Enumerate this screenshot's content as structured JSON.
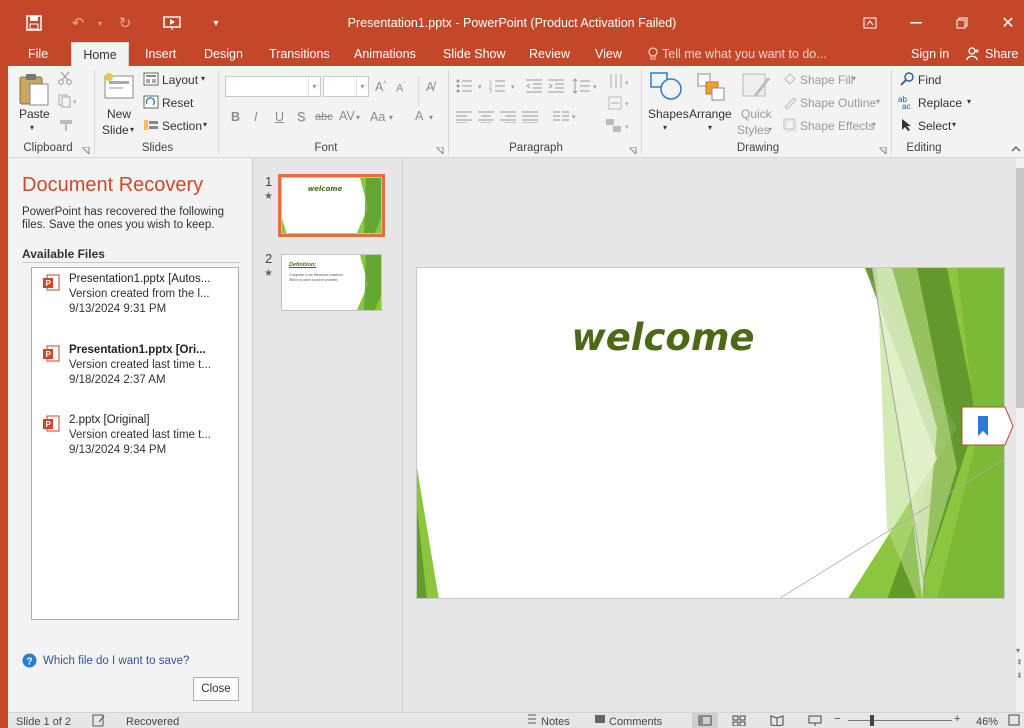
{
  "window": {
    "title": "Presentation1.pptx - PowerPoint (Product Activation Failed)",
    "accent_color": "#c4472a"
  },
  "ribbon_tabs": [
    "File",
    "Home",
    "Insert",
    "Design",
    "Transitions",
    "Animations",
    "Slide Show",
    "Review",
    "View"
  ],
  "tell_me": "Tell me what you want to do...",
  "sign_in": "Sign in",
  "share": "Share",
  "ribbon": {
    "clipboard": {
      "paste": "Paste",
      "label": "Clipboard"
    },
    "slides": {
      "new_slide_line1": "New",
      "new_slide_line2": "Slide",
      "layout": "Layout",
      "reset": "Reset",
      "section": "Section",
      "label": "Slides"
    },
    "font": {
      "label": "Font",
      "bold": "B",
      "italic": "I",
      "underline": "U",
      "shadow": "S",
      "strike": "abc",
      "spacing": "AV",
      "case": "Aa",
      "color": "A"
    },
    "paragraph": {
      "label": "Paragraph"
    },
    "drawing": {
      "shapes": "Shapes",
      "arrange": "Arrange",
      "quick_styles_line1": "Quick",
      "quick_styles_line2": "Styles",
      "shape_fill": "Shape Fill",
      "shape_outline": "Shape Outline",
      "shape_effects": "Shape Effects",
      "label": "Drawing"
    },
    "editing": {
      "find": "Find",
      "replace": "Replace",
      "select": "Select",
      "label": "Editing"
    }
  },
  "recovery": {
    "title": "Document Recovery",
    "description": "PowerPoint has recovered the following files.  Save the ones you wish to keep.",
    "available_files": "Available Files",
    "files": [
      {
        "name": "Presentation1.pptx  [Autos...",
        "line2": "Version created from the l...",
        "date": "9/13/2024 9:31 PM",
        "bold": false
      },
      {
        "name": "Presentation1.pptx  [Ori...",
        "line2": "Version created last time t...",
        "date": "9/18/2024 2:37 AM",
        "bold": true
      },
      {
        "name": "2.pptx  [Original]",
        "line2": "Version created last time t...",
        "date": "9/13/2024 9:34 PM",
        "bold": false
      }
    ],
    "help_link": "Which file do I want to save?",
    "close": "Close"
  },
  "thumbnails": [
    {
      "number": "1",
      "star": "★",
      "title": "welcome"
    },
    {
      "number": "2",
      "star": "★",
      "title": "Definition:",
      "body_line1": "Computer is an electronic machine.",
      "body_line2": "Which is used to solve problem."
    }
  ],
  "slide": {
    "title": "welcome"
  },
  "status": {
    "slide_of": "Slide 1 of 2",
    "recovered": "Recovered",
    "notes": "Notes",
    "comments": "Comments",
    "zoom": "46%"
  }
}
